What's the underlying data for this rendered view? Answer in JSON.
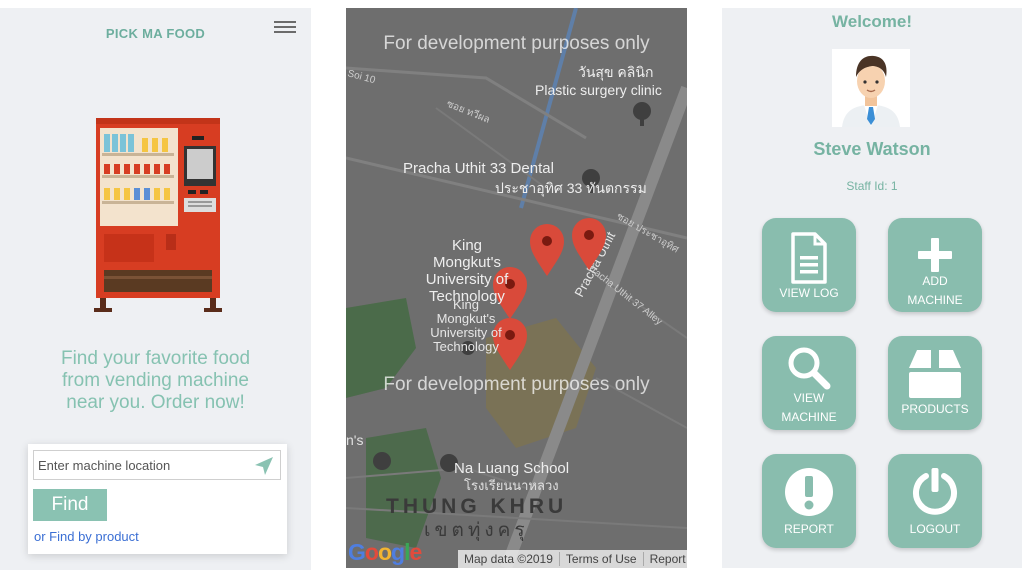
{
  "screen1": {
    "app_title": "PICK MA FOOD",
    "tagline_lines": [
      "Find your favorite food",
      "from vending machine",
      "near you. Order now!"
    ],
    "location_placeholder": "Enter machine location",
    "find_label": "Find",
    "find_by_product_label": "or Find by product",
    "accent_color": "#8ac2b2",
    "icons": [
      "menu-icon",
      "vending-machine-illustration",
      "navigation-arrow-icon"
    ]
  },
  "screen2": {
    "watermark": "For development purposes only",
    "map_labels": {
      "road_soi10": "Soi 10",
      "thai_clinic": "วันสุข คลินิก",
      "clinic": "Plastic surgery clinic",
      "soi_thai": "ซอย ทวีผล",
      "dental": "Pracha Uthit 33 Dental",
      "dental_thai": "ประชาอุทิศ 33 ทันตกรรม",
      "kmutt1": "King Mongkut's University of Technology",
      "kmutt2": "King Mongkut's University of Technology",
      "pracha_uthit": "Pracha Uthit",
      "pracha_uthit_37": "Pracha Uthit 37 Alley",
      "soi_pracha": "ซอย ประชาอุทิศ",
      "school": "Na Luang School",
      "school_thai": "โรงเรียนนาหลวง",
      "district": "THUNG KHRU",
      "district_thai": "เขตทุ่งครุ",
      "edge_label": "n's"
    },
    "logo": "Google",
    "attribution": [
      "Map data ©2019",
      "Terms of Use",
      "Report a map error"
    ],
    "pin_count": 4
  },
  "screen3": {
    "welcome": "Welcome!",
    "user_name": "Steve Watson",
    "staff_id": "Staff Id: 1",
    "tiles": [
      {
        "label_lines": [
          "VIEW LOG"
        ],
        "icon": "document-icon"
      },
      {
        "label_lines": [
          "ADD",
          "MACHINE"
        ],
        "icon": "plus-icon"
      },
      {
        "label_lines": [
          "VIEW",
          "MACHINE"
        ],
        "icon": "search-icon"
      },
      {
        "label_lines": [
          "PRODUCTS"
        ],
        "icon": "box-icon"
      },
      {
        "label_lines": [
          "REPORT"
        ],
        "icon": "alert-icon"
      },
      {
        "label_lines": [
          "LOGOUT"
        ],
        "icon": "power-icon"
      }
    ],
    "tile_color": "#89bdae"
  }
}
